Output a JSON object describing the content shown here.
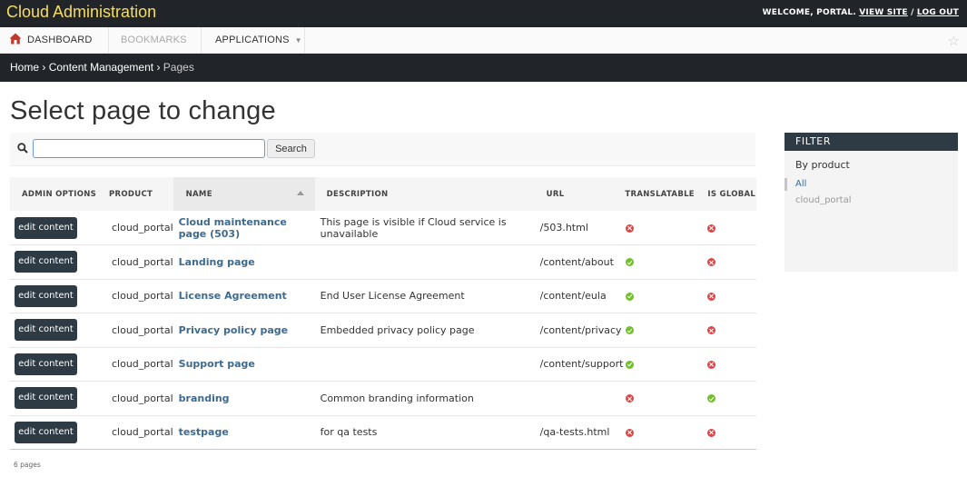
{
  "header": {
    "brand": "Cloud Administration",
    "welcome": "WELCOME, PORTAL.",
    "view_site": "VIEW SITE",
    "separator": "/",
    "log_out": "LOG OUT"
  },
  "nav": {
    "dashboard": "DASHBOARD",
    "bookmarks": "BOOKMARKS",
    "applications": "APPLICATIONS"
  },
  "breadcrumbs": {
    "home": "Home",
    "section": "Content Management",
    "current": "Pages",
    "sep": "›"
  },
  "page_title": "Select page to change",
  "search": {
    "value": "",
    "button": "Search"
  },
  "table": {
    "columns": {
      "admin": "ADMIN OPTIONS",
      "product": "PRODUCT",
      "name": "NAME",
      "description": "DESCRIPTION",
      "url": "URL",
      "translatable": "TRANSLATABLE",
      "is_global": "IS GLOBAL"
    },
    "edit_label": "edit content",
    "rows": [
      {
        "product": "cloud_portal",
        "name": "Cloud maintenance page (503)",
        "description": "This page is visible if Cloud service is unavailable",
        "url": "/503.html",
        "translatable": false,
        "is_global": false
      },
      {
        "product": "cloud_portal",
        "name": "Landing page",
        "description": "",
        "url": "/content/about",
        "translatable": true,
        "is_global": false
      },
      {
        "product": "cloud_portal",
        "name": "License Agreement",
        "description": "End User License Agreement",
        "url": "/content/eula",
        "translatable": true,
        "is_global": false
      },
      {
        "product": "cloud_portal",
        "name": "Privacy policy page",
        "description": "Embedded privacy policy page",
        "url": "/content/privacy",
        "translatable": true,
        "is_global": false
      },
      {
        "product": "cloud_portal",
        "name": "Support page",
        "description": "",
        "url": "/content/support",
        "translatable": true,
        "is_global": false
      },
      {
        "product": "cloud_portal",
        "name": "branding",
        "description": "Common branding information",
        "url": "",
        "translatable": false,
        "is_global": true
      },
      {
        "product": "cloud_portal",
        "name": "testpage",
        "description": "for qa tests",
        "url": "/qa-tests.html",
        "translatable": false,
        "is_global": false
      }
    ]
  },
  "paginator": "6 pages",
  "filter": {
    "title": "FILTER",
    "by": "By product",
    "options": [
      "All",
      "cloud_portal"
    ],
    "selected": "All"
  },
  "colors": {
    "header_bg": "#212529",
    "brand": "#f5dd5d",
    "link": "#3e6a8e",
    "button_bg": "#2f3b44",
    "icon_yes": "#70bf2b",
    "icon_no": "#dd4646"
  }
}
